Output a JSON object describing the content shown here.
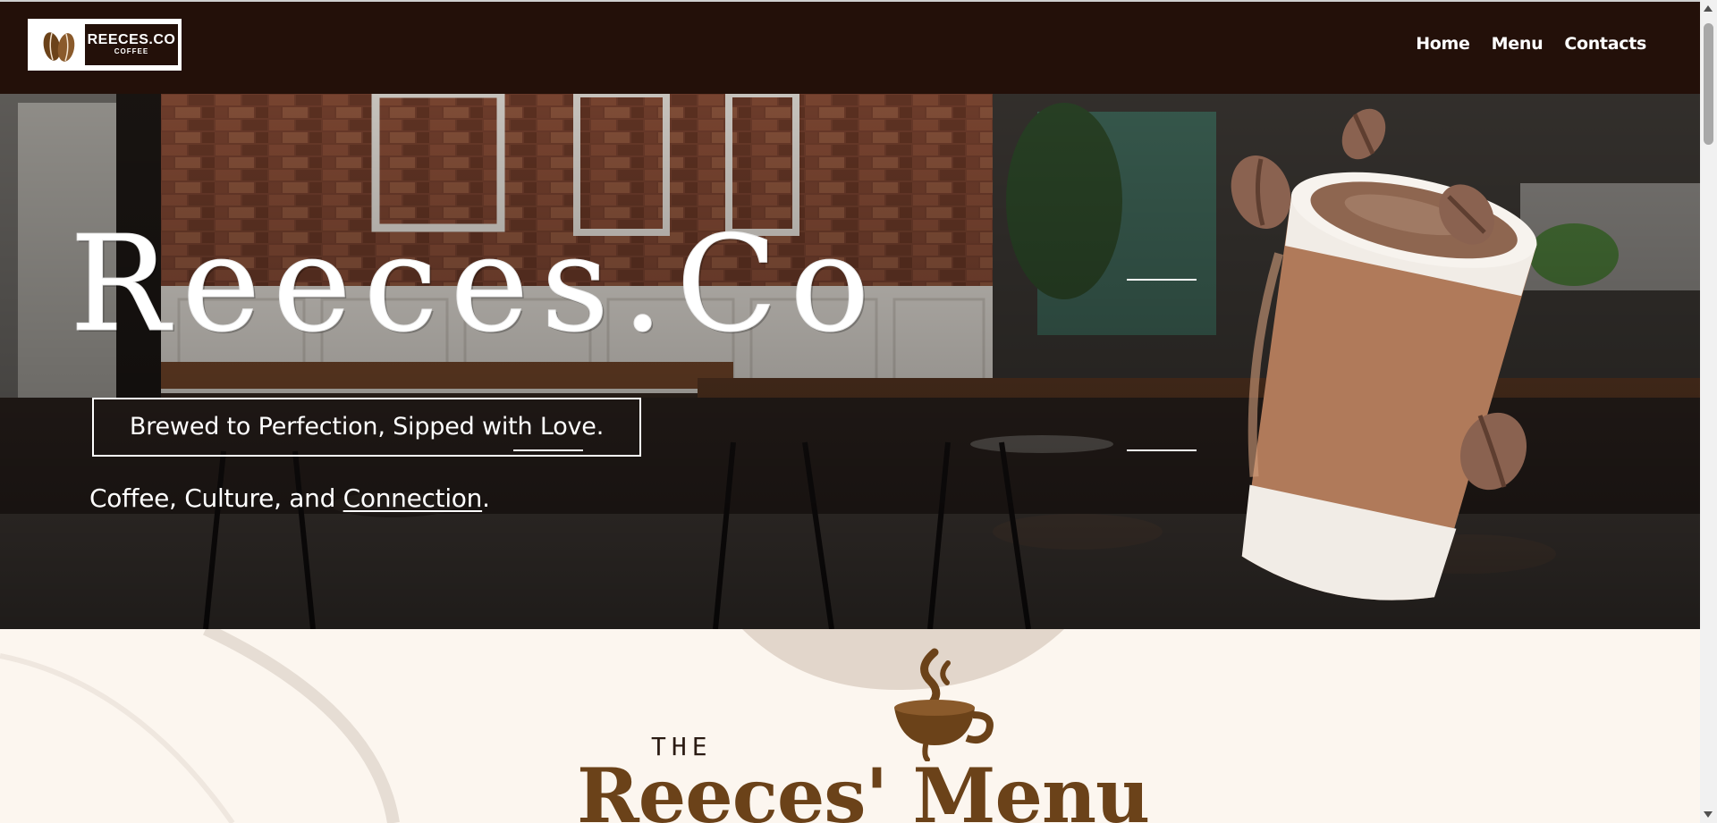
{
  "nav": {
    "logo": {
      "title": "REECES.CO",
      "subtitle": "COFFEE",
      "icon": "coffee-beans-icon"
    },
    "links": [
      {
        "label": "Home"
      },
      {
        "label": "Menu"
      },
      {
        "label": "Contacts"
      }
    ]
  },
  "hero": {
    "title": "Reeces.Co",
    "tagline": "Brewed to Perfection, Sipped with Love.",
    "subline_before": "Coffee, Culture, and ",
    "subline_link": "Connection",
    "subline_after": ".",
    "image": "coffee-cup-with-beans-icon"
  },
  "menu_section": {
    "label_the": "THE",
    "heading": "Reeces' Menu",
    "icon": "steaming-coffee-cup-icon"
  },
  "colors": {
    "navbar_bg": "#231009",
    "accent_brown": "#6b4219",
    "cream_bg": "#fcf6ef",
    "white": "#ffffff"
  }
}
